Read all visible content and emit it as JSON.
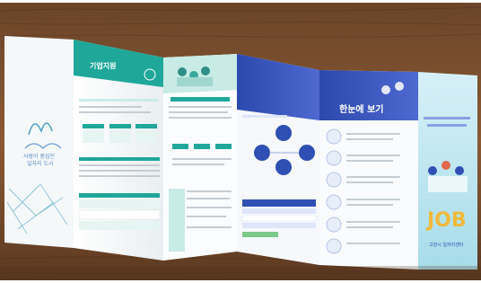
{
  "photo": {
    "subject": "folded brochure on wooden table",
    "colors": {
      "wood_dark": "#5b3a22",
      "wood_mid": "#8a5a34",
      "wood_light": "#b07a4a",
      "paper": "#f7f9fa",
      "teal": "#1fa79a",
      "teal_light": "#c9ece8",
      "blue": "#2f4fb3",
      "blue_light": "#5a72d6",
      "sky": "#bfe6f2",
      "gray_text": "#9aa3aa"
    }
  },
  "brochure": {
    "panel2": {
      "tag": "기업지원",
      "title": "기업지원"
    },
    "panel5": {
      "title": "한눈에 보기"
    },
    "cover": {
      "brand": "JOB",
      "subtitle": "고양시 일자리센터"
    }
  }
}
